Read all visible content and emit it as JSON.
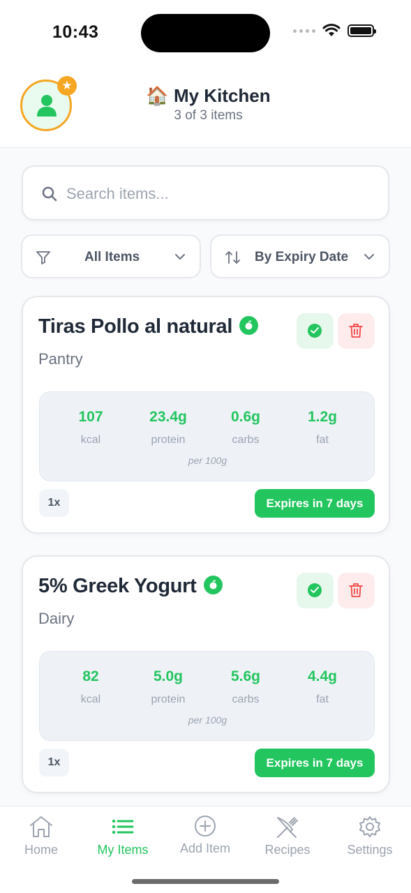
{
  "status_bar": {
    "time": "10:43"
  },
  "header": {
    "avatar_badge": "★",
    "emoji": "🏠",
    "title": "My Kitchen",
    "subtitle": "3 of 3 items"
  },
  "search": {
    "placeholder": "Search items...",
    "value": ""
  },
  "filters": {
    "category": {
      "selected": "All Items"
    },
    "sort": {
      "selected": "By Expiry Date"
    }
  },
  "items": [
    {
      "name": "Tiras Pollo al natural",
      "category": "Pantry",
      "nutrition": {
        "kcal": "107",
        "kcal_label": "kcal",
        "protein": "23.4g",
        "protein_label": "protein",
        "carbs": "0.6g",
        "carbs_label": "carbs",
        "fat": "1.2g",
        "fat_label": "fat",
        "note": "per 100g"
      },
      "quantity": "1x",
      "expiry": "Expires in 7 days"
    },
    {
      "name": "5% Greek Yogurt",
      "category": "Dairy",
      "nutrition": {
        "kcal": "82",
        "kcal_label": "kcal",
        "protein": "5.0g",
        "protein_label": "protein",
        "carbs": "5.6g",
        "carbs_label": "carbs",
        "fat": "4.4g",
        "fat_label": "fat",
        "note": "per 100g"
      },
      "quantity": "1x",
      "expiry": "Expires in 7 days"
    }
  ],
  "bottom_nav": {
    "items": [
      {
        "label": "Home",
        "icon": "home-icon"
      },
      {
        "label": "My Items",
        "icon": "list-icon",
        "active": true
      },
      {
        "label": "Add Item",
        "icon": "plus-circle-icon"
      },
      {
        "label": "Recipes",
        "icon": "utensils-icon"
      },
      {
        "label": "Settings",
        "icon": "gear-icon"
      }
    ]
  },
  "colors": {
    "accent": "#22c55e",
    "avatar_ring": "#f5a623",
    "delete": "#ef4444",
    "background": "#f8fafc"
  }
}
